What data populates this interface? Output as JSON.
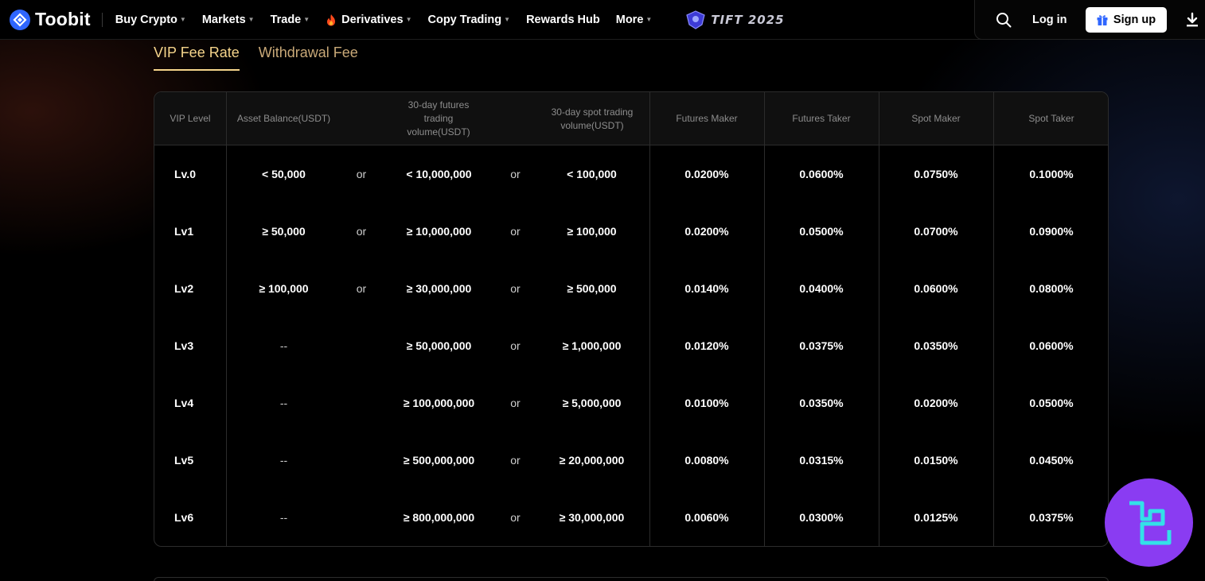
{
  "header": {
    "logo_text": "Toobit",
    "nav": [
      {
        "label": "Buy Crypto",
        "caret": true
      },
      {
        "label": "Markets",
        "caret": true
      },
      {
        "label": "Trade",
        "caret": true
      },
      {
        "label": "Derivatives",
        "caret": true
      },
      {
        "label": "Copy Trading",
        "caret": true
      },
      {
        "label": "Rewards Hub",
        "caret": false
      },
      {
        "label": "More",
        "caret": true
      }
    ],
    "event_badge": "TIFT 2025",
    "login_label": "Log in",
    "signup_label": "Sign up",
    "icons": [
      "search-icon",
      "gift-icon",
      "download-icon",
      "fire-icon"
    ]
  },
  "tabs": [
    {
      "label": "VIP Fee Rate",
      "active": true
    },
    {
      "label": "Withdrawal Fee",
      "active": false
    }
  ],
  "table": {
    "headers": [
      "VIP Level",
      "Asset Balance(USDT)",
      "30-day futures trading volume(USDT)",
      "30-day spot trading volume(USDT)",
      "Futures Maker",
      "Futures Taker",
      "Spot Maker",
      "Spot Taker"
    ],
    "rows": [
      {
        "level": "Lv.0",
        "balance": "< 50,000",
        "or1": "or",
        "futures_vol": "< 10,000,000",
        "or2": "or",
        "spot_vol": "< 100,000",
        "futures_maker": "0.0200%",
        "futures_taker": "0.0600%",
        "spot_maker": "0.0750%",
        "spot_taker": "0.1000%"
      },
      {
        "level": "Lv1",
        "balance": "≥ 50,000",
        "or1": "or",
        "futures_vol": "≥ 10,000,000",
        "or2": "or",
        "spot_vol": "≥ 100,000",
        "futures_maker": "0.0200%",
        "futures_taker": "0.0500%",
        "spot_maker": "0.0700%",
        "spot_taker": "0.0900%"
      },
      {
        "level": "Lv2",
        "balance": "≥ 100,000",
        "or1": "or",
        "futures_vol": "≥ 30,000,000",
        "or2": "or",
        "spot_vol": "≥ 500,000",
        "futures_maker": "0.0140%",
        "futures_taker": "0.0400%",
        "spot_maker": "0.0600%",
        "spot_taker": "0.0800%"
      },
      {
        "level": "Lv3",
        "balance": "--",
        "or1": "",
        "futures_vol": "≥ 50,000,000",
        "or2": "or",
        "spot_vol": "≥ 1,000,000",
        "futures_maker": "0.0120%",
        "futures_taker": "0.0375%",
        "spot_maker": "0.0350%",
        "spot_taker": "0.0600%"
      },
      {
        "level": "Lv4",
        "balance": "--",
        "or1": "",
        "futures_vol": "≥ 100,000,000",
        "or2": "or",
        "spot_vol": "≥ 5,000,000",
        "futures_maker": "0.0100%",
        "futures_taker": "0.0350%",
        "spot_maker": "0.0200%",
        "spot_taker": "0.0500%"
      },
      {
        "level": "Lv5",
        "balance": "--",
        "or1": "",
        "futures_vol": "≥ 500,000,000",
        "or2": "or",
        "spot_vol": "≥ 20,000,000",
        "futures_maker": "0.0080%",
        "futures_taker": "0.0315%",
        "spot_maker": "0.0150%",
        "spot_taker": "0.0450%"
      },
      {
        "level": "Lv6",
        "balance": "--",
        "or1": "",
        "futures_vol": "≥ 800,000,000",
        "or2": "or",
        "spot_vol": "≥ 30,000,000",
        "futures_maker": "0.0060%",
        "futures_taker": "0.0300%",
        "spot_maker": "0.0125%",
        "spot_taker": "0.0375%"
      }
    ]
  },
  "colors": {
    "accent_gold": "#f5d48b",
    "brand_blue": "#2f66ff",
    "badge_purple": "#8a3cf2",
    "badge_cyan": "#33e0e8"
  }
}
